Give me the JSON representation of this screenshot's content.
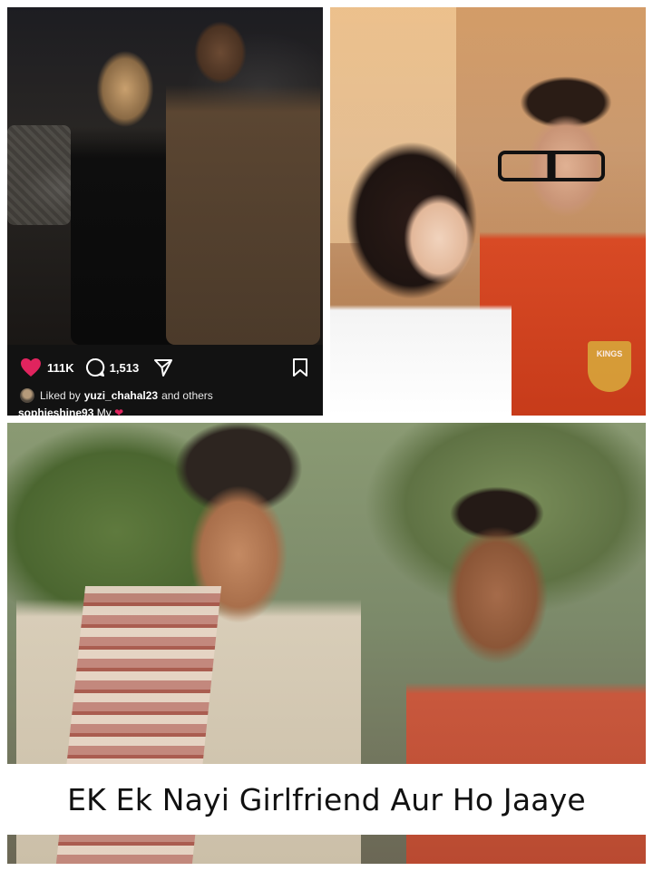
{
  "instagram_post": {
    "like_count": "111K",
    "comment_count": "1,513",
    "liked_by_prefix": "Liked by",
    "liked_by_user": "yuzi_chahal23",
    "liked_by_suffix": "and others",
    "caption_user": "sophieshine93",
    "caption_text": "My",
    "caption_emoji": "❤",
    "icons": [
      "heart-icon",
      "comment-icon",
      "send-icon",
      "bookmark-icon"
    ],
    "heart_color": "#e0245e"
  },
  "top_right_photo": {
    "jersey_badge": "KINGS"
  },
  "meme_caption": "EK Ek Nayi Girlfriend Aur Ho Jaaye"
}
